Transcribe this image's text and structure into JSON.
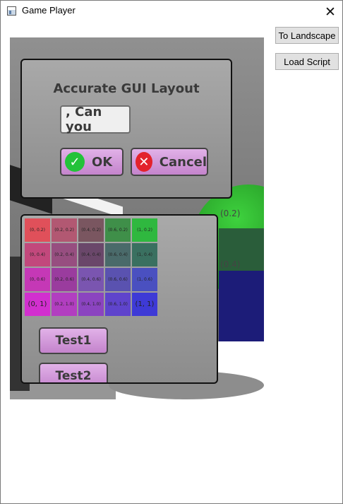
{
  "window": {
    "title": "Game Player",
    "close_glyph": "✕"
  },
  "side_buttons": {
    "landscape": "To Landscape",
    "load_script": "Load Script"
  },
  "scene_labels": {
    "ball_top": "(0.2)",
    "ball_mid": "(0.4)"
  },
  "dialog": {
    "title": "Accurate GUI Layout",
    "textfield_value": ", Can you",
    "ok_label": "OK",
    "cancel_label": "Cancel",
    "ok_icon": "✓",
    "cancel_icon": "✕"
  },
  "grid": {
    "cells": [
      {
        "label": "(0, 0.2)",
        "color": "#e0505a"
      },
      {
        "label": "(0.2, 0.2)",
        "color": "#b25872"
      },
      {
        "label": "(0.4, 0.2)",
        "color": "#7a5660"
      },
      {
        "label": "(0.6, 0.2)",
        "color": "#3f8f49"
      },
      {
        "label": "(1, 0.2)",
        "color": "#2fb83f"
      },
      {
        "label": "(0, 0.4)",
        "color": "#c2487c"
      },
      {
        "label": "(0.2, 0.4)",
        "color": "#974e80"
      },
      {
        "label": "(0.4, 0.4)",
        "color": "#6a476a"
      },
      {
        "label": "(0.6, 0.4)",
        "color": "#4a6a6a"
      },
      {
        "label": "(1, 0.4)",
        "color": "#3a7060"
      },
      {
        "label": "(0, 0.6)",
        "color": "#c538b6"
      },
      {
        "label": "(0.2, 0.6)",
        "color": "#9a3c9e"
      },
      {
        "label": "(0.4, 0.6)",
        "color": "#7a55b0"
      },
      {
        "label": "(0.6, 0.6)",
        "color": "#5a52b0"
      },
      {
        "label": "(1, 0.6)",
        "color": "#4a50c0"
      },
      {
        "label": "(0, 1)",
        "color": "#d22fcf",
        "big": true
      },
      {
        "label": "(0.2, 1.0)",
        "color": "#b23ec0"
      },
      {
        "label": "(0.4, 1.0)",
        "color": "#8b44c0"
      },
      {
        "label": "(0.6, 1.0)",
        "color": "#5f44cc"
      },
      {
        "label": "(1, 1)",
        "color": "#3e3ad6",
        "big": true
      }
    ]
  },
  "tests": {
    "test1": "Test1",
    "test2": "Test2"
  }
}
